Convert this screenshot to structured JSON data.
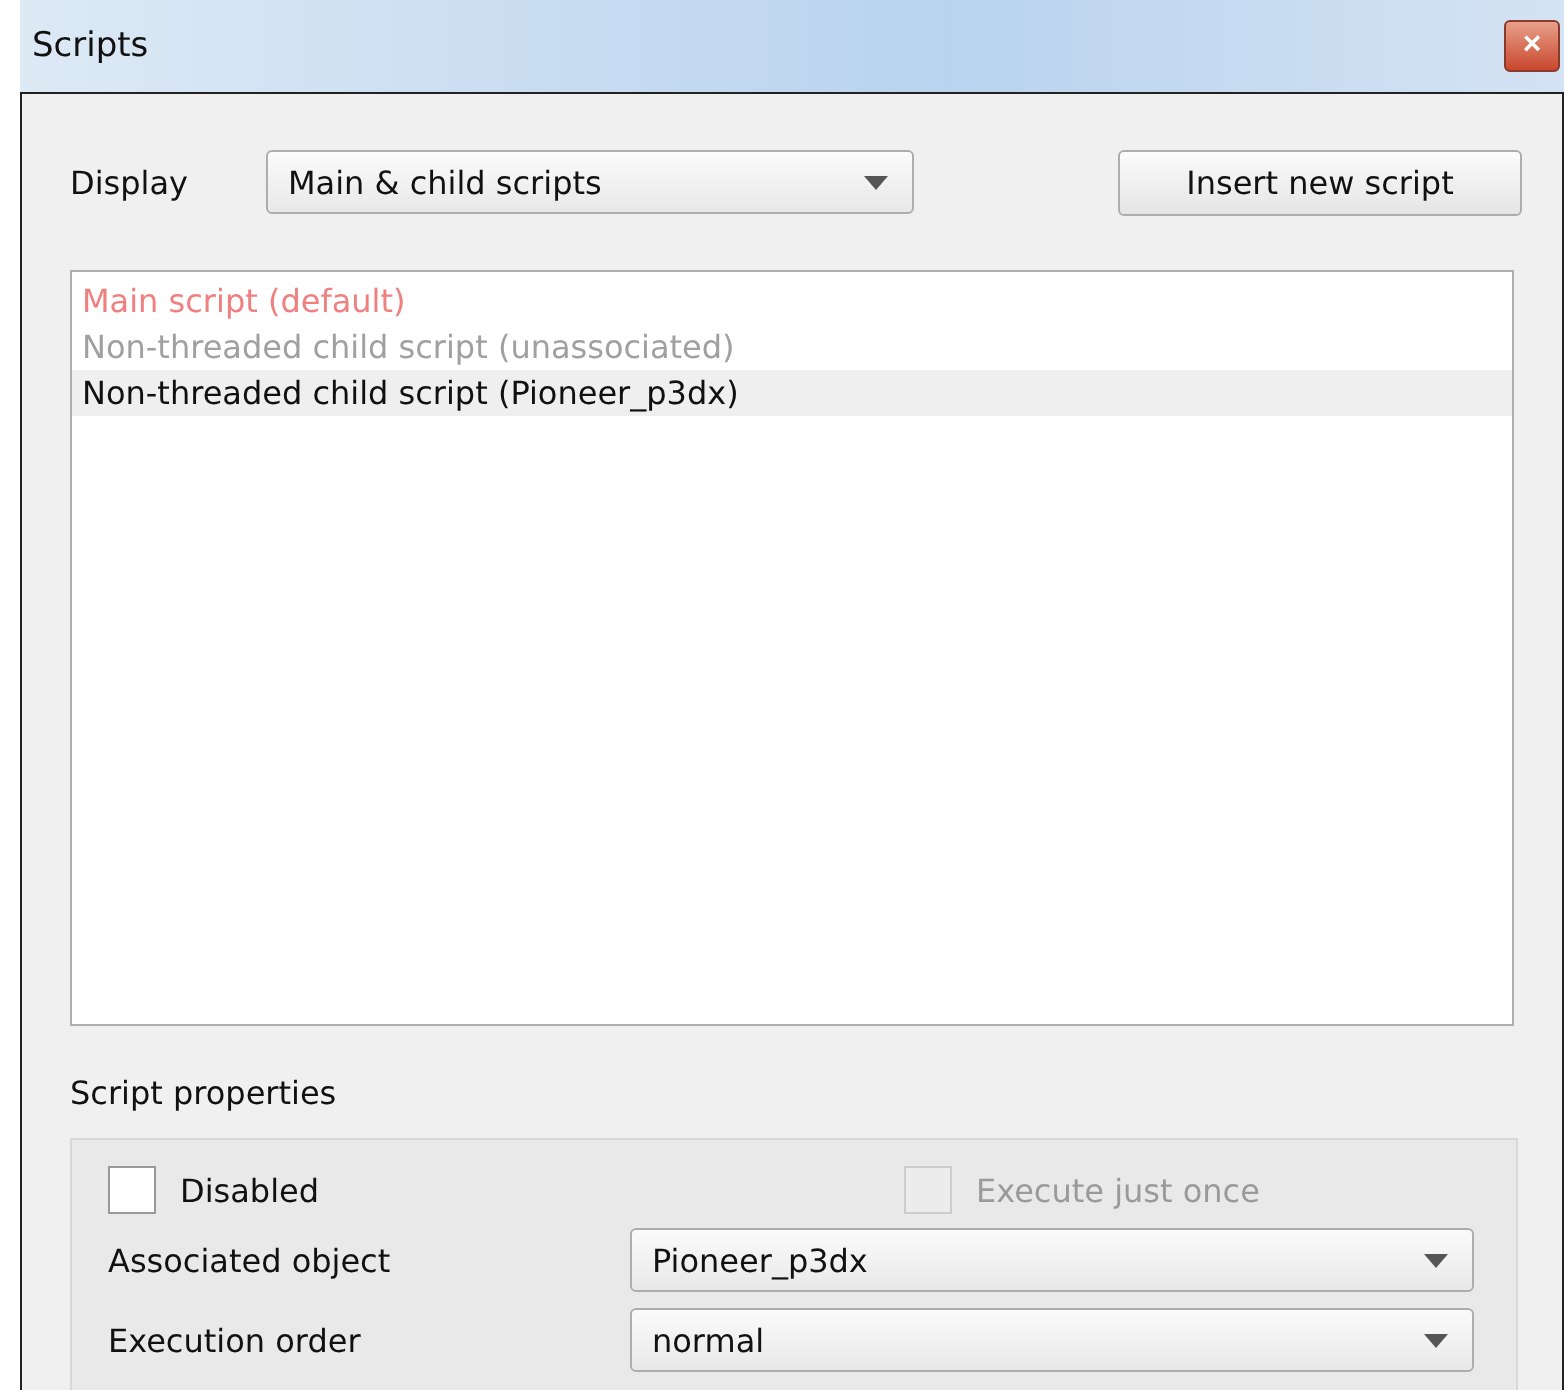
{
  "window": {
    "title": "Scripts",
    "close": "×"
  },
  "display": {
    "label": "Display",
    "value": "Main & child scripts"
  },
  "insert_button": "Insert new script",
  "scripts": [
    {
      "label": "Main script (default)",
      "kind": "main",
      "selected": false
    },
    {
      "label": "Non-threaded child script (unassociated)",
      "kind": "unassociated",
      "selected": false
    },
    {
      "label": "Non-threaded child script (Pioneer_p3dx)",
      "kind": "associated",
      "selected": true
    }
  ],
  "properties": {
    "title": "Script properties",
    "checkboxes": [
      {
        "label": "Disabled",
        "checked": false,
        "disabled": false
      },
      {
        "label": "Execute just once",
        "checked": false,
        "disabled": true
      }
    ],
    "fields": [
      {
        "label": "Associated object",
        "value": "Pioneer_p3dx"
      },
      {
        "label": "Execution order",
        "value": "normal"
      }
    ]
  }
}
